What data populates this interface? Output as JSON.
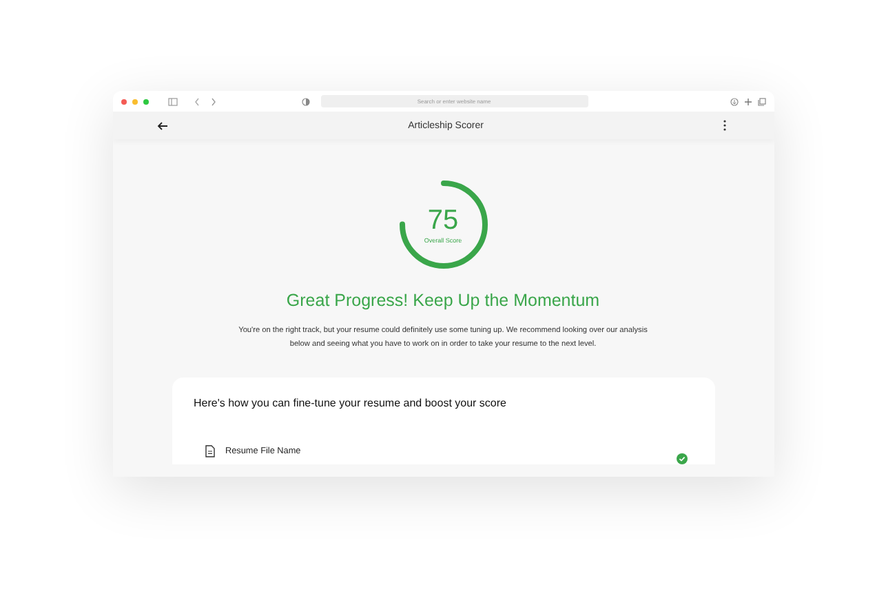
{
  "browser": {
    "address_placeholder": "Search or enter website name"
  },
  "header": {
    "title": "Articleship Scorer"
  },
  "score": {
    "value": "75",
    "label": "Overall Score",
    "level": 0.75
  },
  "headline": "Great Progress! Keep Up the Momentum",
  "summary": "You're on the right track, but your resume could definitely use some tuning up. We recommend looking over our analysis below and seeing what you have to work on in order to take your resume to the next level.",
  "card": {
    "title": "Here's how you can fine-tune your resume and boost your score",
    "items": [
      {
        "title": "Resume File Name",
        "passed": true
      }
    ]
  }
}
